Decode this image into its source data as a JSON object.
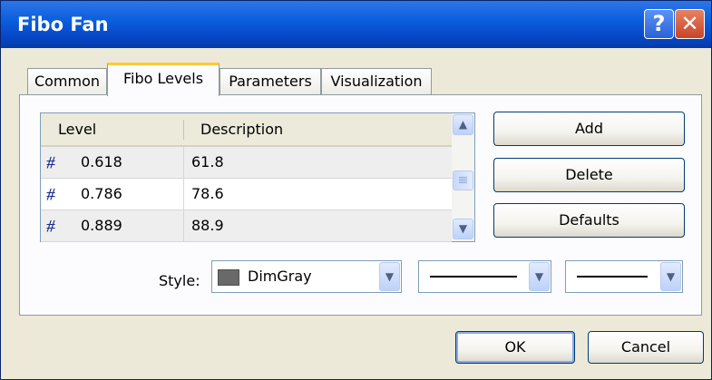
{
  "window": {
    "title": "Fibo Fan"
  },
  "titlebar": {
    "help_glyph": "?",
    "close_glyph": "✕"
  },
  "tabs": [
    {
      "label": "Common",
      "active": false
    },
    {
      "label": "Fibo Levels",
      "active": true
    },
    {
      "label": "Parameters",
      "active": false
    },
    {
      "label": "Visualization",
      "active": false
    }
  ],
  "levels_table": {
    "columns": [
      "Level",
      "Description"
    ],
    "rows": [
      {
        "level": "0.618",
        "description": "61.8"
      },
      {
        "level": "0.786",
        "description": "78.6"
      },
      {
        "level": "0.889",
        "description": "88.9"
      }
    ],
    "row_icon": "level-line-icon"
  },
  "scroll": {
    "up_glyph": "▲",
    "down_glyph": "▼"
  },
  "actions": {
    "add": "Add",
    "delete": "Delete",
    "defaults": "Defaults"
  },
  "style": {
    "label": "Style:",
    "color_name": "DimGray",
    "color_value": "#696969",
    "line_style": "solid",
    "line_width": "solid",
    "dropdown_glyph": "▼"
  },
  "footer": {
    "ok": "OK",
    "cancel": "Cancel"
  },
  "colors": {
    "titlebar": "#0b5fde",
    "dialog_bg": "#ece9d8",
    "active_tab_accent": "#ffc83c"
  }
}
